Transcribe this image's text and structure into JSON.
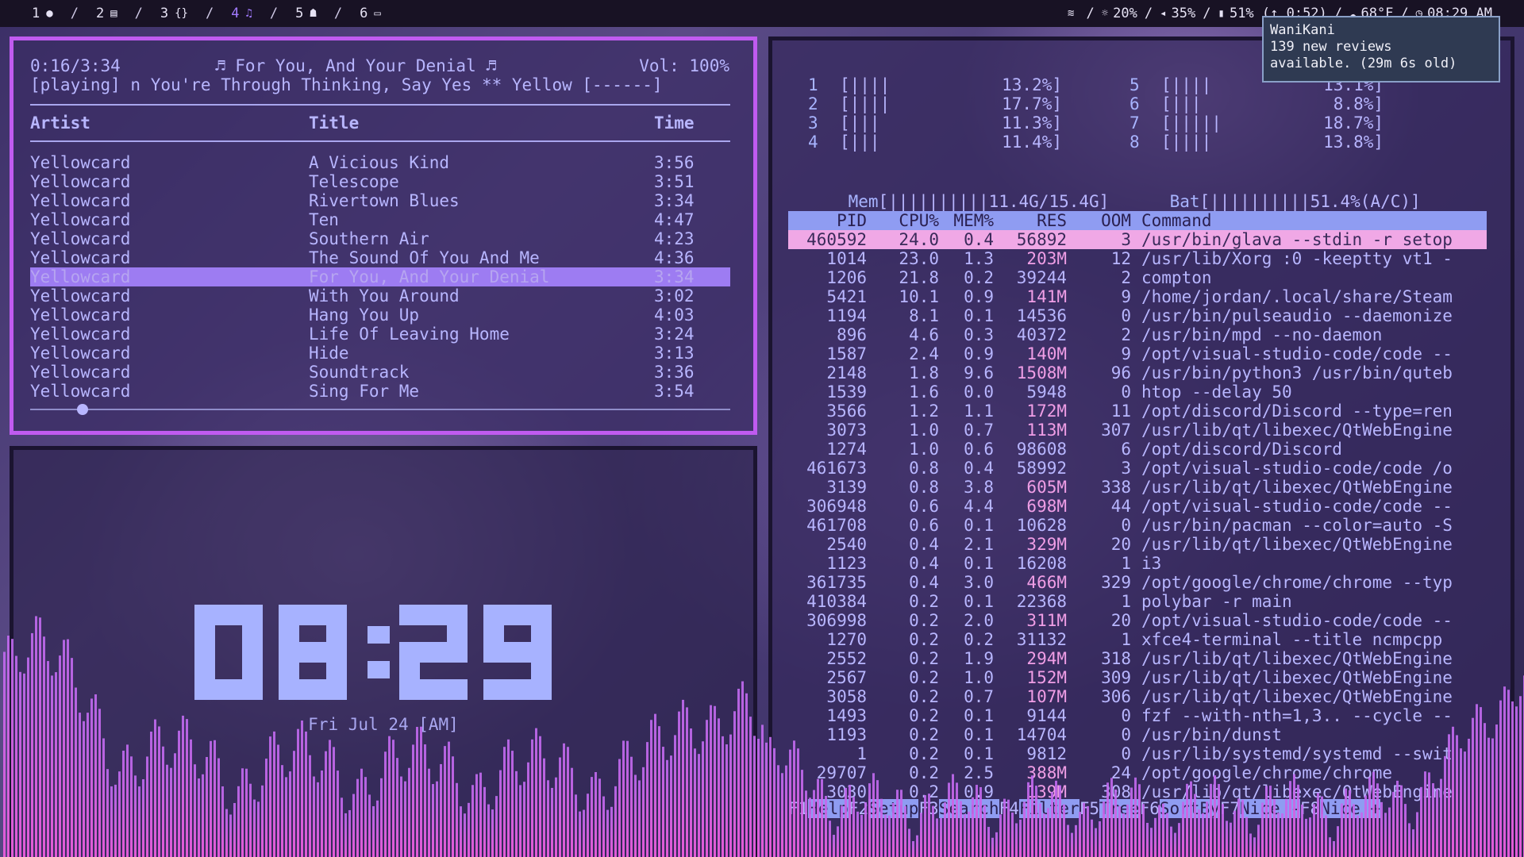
{
  "topbar": {
    "workspaces": [
      {
        "num": "1",
        "icon": "●",
        "icon_name": "circle-icon"
      },
      {
        "num": "2",
        "icon": "▤",
        "icon_name": "envelope-icon"
      },
      {
        "num": "3",
        "icon": "{}",
        "icon_name": "code-braces-icon"
      },
      {
        "num": "4",
        "icon": "♫",
        "icon_name": "headphones-icon",
        "active": true
      },
      {
        "num": "5",
        "icon": "☗",
        "icon_name": "gamepad-icon"
      },
      {
        "num": "6",
        "icon": "▭",
        "icon_name": "chat-icon"
      }
    ],
    "separator": "/",
    "status": [
      {
        "icon": "≋",
        "icon_name": "wifi-icon",
        "text": ""
      },
      {
        "icon": "☼",
        "icon_name": "brightness-icon",
        "text": "20%"
      },
      {
        "icon": "◂",
        "icon_name": "volume-icon",
        "text": "35%"
      },
      {
        "icon": "▮",
        "icon_name": "battery-icon",
        "text": "51% (↑ 0:52)"
      },
      {
        "icon": "☁",
        "icon_name": "weather-icon",
        "text": "68°F"
      },
      {
        "icon": "◷",
        "icon_name": "clock-icon",
        "text": "08:29 AM"
      }
    ],
    "active_color": "#a27bff"
  },
  "notification": {
    "title": "WaniKani",
    "line1": "139 new reviews",
    "line2": "available. (29m 6s old)"
  },
  "ncmpcpp": {
    "time": "0:16/3:34",
    "now_playing": "♬ For You, And Your Denial ♬",
    "volume": "Vol: 100%",
    "status_line": "[playing] n You're Through Thinking, Say Yes ** Yellow [------]",
    "columns": {
      "artist": "Artist",
      "title": "Title",
      "time": "Time"
    },
    "tracks": [
      {
        "artist": "Yellowcard",
        "title": "A Vicious Kind",
        "time": "3:56"
      },
      {
        "artist": "Yellowcard",
        "title": "Telescope",
        "time": "3:51"
      },
      {
        "artist": "Yellowcard",
        "title": "Rivertown Blues",
        "time": "3:34"
      },
      {
        "artist": "Yellowcard",
        "title": "Ten",
        "time": "4:47"
      },
      {
        "artist": "Yellowcard",
        "title": "Southern Air",
        "time": "4:23"
      },
      {
        "artist": "Yellowcard",
        "title": "The Sound Of You And Me",
        "time": "4:36"
      },
      {
        "artist": "Yellowcard",
        "title": "For You, And Your Denial",
        "time": "3:34",
        "selected": true
      },
      {
        "artist": "Yellowcard",
        "title": "With You Around",
        "time": "3:02"
      },
      {
        "artist": "Yellowcard",
        "title": "Hang You Up",
        "time": "4:03"
      },
      {
        "artist": "Yellowcard",
        "title": "Life Of Leaving Home",
        "time": "3:24"
      },
      {
        "artist": "Yellowcard",
        "title": "Hide",
        "time": "3:13"
      },
      {
        "artist": "Yellowcard",
        "title": "Soundtrack",
        "time": "3:36"
      },
      {
        "artist": "Yellowcard",
        "title": "Sing For Me",
        "time": "3:54"
      }
    ],
    "progress_fraction": 0.075,
    "border_color": "#c05bf0"
  },
  "clock": {
    "time": "08:29",
    "date": "Fri Jul 24 [AM]",
    "digit_color": "#a7b2ff"
  },
  "htop": {
    "cpus": [
      {
        "id": "1",
        "bar": "[||||",
        "pct": "13.2%]"
      },
      {
        "id": "2",
        "bar": "[||||",
        "pct": "17.7%]"
      },
      {
        "id": "3",
        "bar": "[|||",
        "pct": "11.3%]"
      },
      {
        "id": "4",
        "bar": "[|||",
        "pct": "11.4%]"
      },
      {
        "id": "5",
        "bar": "[||||",
        "pct": "13.1%]"
      },
      {
        "id": "6",
        "bar": "[|||",
        "pct": "8.8%]"
      },
      {
        "id": "7",
        "bar": "[|||||",
        "pct": "18.7%]"
      },
      {
        "id": "8",
        "bar": "[||||",
        "pct": "13.8%]"
      }
    ],
    "mem": {
      "label": "Mem",
      "bar": "[||||||||||",
      "value": "11.4G/15.4G]"
    },
    "bat": {
      "label": "Bat",
      "bar": "[||||||||||",
      "value": "51.4%(A/C)]"
    },
    "headers": {
      "pid": "PID",
      "cpu": "CPU%",
      "mem": "MEM%",
      "res": "RES",
      "oom": "OOM",
      "command": "Command"
    },
    "processes": [
      {
        "pid": "460592",
        "cpu": "24.0",
        "mem": "0.4",
        "res": "56892",
        "oom": "3",
        "cmd": "/usr/bin/glava --stdin -r setop",
        "selected": true
      },
      {
        "pid": "1014",
        "cpu": "23.0",
        "mem": "1.3",
        "res": "203M",
        "oom": "12",
        "cmd": "/usr/lib/Xorg :0 -keeptty vt1 -"
      },
      {
        "pid": "1206",
        "cpu": "21.8",
        "mem": "0.2",
        "res": "39244",
        "oom": "2",
        "cmd": "compton"
      },
      {
        "pid": "5421",
        "cpu": "10.1",
        "mem": "0.9",
        "res": "141M",
        "oom": "9",
        "cmd": "/home/jordan/.local/share/Steam"
      },
      {
        "pid": "1194",
        "cpu": "8.1",
        "mem": "0.1",
        "res": "14536",
        "oom": "0",
        "cmd": "/usr/bin/pulseaudio --daemonize"
      },
      {
        "pid": "896",
        "cpu": "4.6",
        "mem": "0.3",
        "res": "40372",
        "oom": "2",
        "cmd": "/usr/bin/mpd --no-daemon"
      },
      {
        "pid": "1587",
        "cpu": "2.4",
        "mem": "0.9",
        "res": "140M",
        "oom": "9",
        "cmd": "/opt/visual-studio-code/code --"
      },
      {
        "pid": "2148",
        "cpu": "1.8",
        "mem": "9.6",
        "res": "1508M",
        "oom": "96",
        "cmd": "/usr/bin/python3 /usr/bin/quteb"
      },
      {
        "pid": "1539",
        "cpu": "1.6",
        "mem": "0.0",
        "res": "5948",
        "oom": "0",
        "cmd": "htop --delay 50"
      },
      {
        "pid": "3566",
        "cpu": "1.2",
        "mem": "1.1",
        "res": "172M",
        "oom": "11",
        "cmd": "/opt/discord/Discord --type=ren"
      },
      {
        "pid": "3073",
        "cpu": "1.0",
        "mem": "0.7",
        "res": "113M",
        "oom": "307",
        "cmd": "/usr/lib/qt/libexec/QtWebEngine"
      },
      {
        "pid": "1274",
        "cpu": "1.0",
        "mem": "0.6",
        "res": "98608",
        "oom": "6",
        "cmd": "/opt/discord/Discord"
      },
      {
        "pid": "461673",
        "cpu": "0.8",
        "mem": "0.4",
        "res": "58992",
        "oom": "3",
        "cmd": "/opt/visual-studio-code/code /o"
      },
      {
        "pid": "3139",
        "cpu": "0.8",
        "mem": "3.8",
        "res": "605M",
        "oom": "338",
        "cmd": "/usr/lib/qt/libexec/QtWebEngine"
      },
      {
        "pid": "306948",
        "cpu": "0.6",
        "mem": "4.4",
        "res": "698M",
        "oom": "44",
        "cmd": "/opt/visual-studio-code/code --"
      },
      {
        "pid": "461708",
        "cpu": "0.6",
        "mem": "0.1",
        "res": "10628",
        "oom": "0",
        "cmd": "/usr/bin/pacman --color=auto -S"
      },
      {
        "pid": "2540",
        "cpu": "0.4",
        "mem": "2.1",
        "res": "329M",
        "oom": "20",
        "cmd": "/usr/lib/qt/libexec/QtWebEngine"
      },
      {
        "pid": "1123",
        "cpu": "0.4",
        "mem": "0.1",
        "res": "16208",
        "oom": "1",
        "cmd": "i3"
      },
      {
        "pid": "361735",
        "cpu": "0.4",
        "mem": "3.0",
        "res": "466M",
        "oom": "329",
        "cmd": "/opt/google/chrome/chrome --typ"
      },
      {
        "pid": "410384",
        "cpu": "0.2",
        "mem": "0.1",
        "res": "22368",
        "oom": "1",
        "cmd": "polybar -r main"
      },
      {
        "pid": "306998",
        "cpu": "0.2",
        "mem": "2.0",
        "res": "311M",
        "oom": "20",
        "cmd": "/opt/visual-studio-code/code --"
      },
      {
        "pid": "1270",
        "cpu": "0.2",
        "mem": "0.2",
        "res": "31132",
        "oom": "1",
        "cmd": "xfce4-terminal --title ncmpcpp"
      },
      {
        "pid": "2552",
        "cpu": "0.2",
        "mem": "1.9",
        "res": "294M",
        "oom": "318",
        "cmd": "/usr/lib/qt/libexec/QtWebEngine"
      },
      {
        "pid": "2567",
        "cpu": "0.2",
        "mem": "1.0",
        "res": "152M",
        "oom": "309",
        "cmd": "/usr/lib/qt/libexec/QtWebEngine"
      },
      {
        "pid": "3058",
        "cpu": "0.2",
        "mem": "0.7",
        "res": "107M",
        "oom": "306",
        "cmd": "/usr/lib/qt/libexec/QtWebEngine"
      },
      {
        "pid": "1493",
        "cpu": "0.2",
        "mem": "0.1",
        "res": "9144",
        "oom": "0",
        "cmd": "fzf --with-nth=1,3.. --cycle --"
      },
      {
        "pid": "1193",
        "cpu": "0.2",
        "mem": "0.1",
        "res": "14704",
        "oom": "0",
        "cmd": "/usr/bin/dunst"
      },
      {
        "pid": "1",
        "cpu": "0.2",
        "mem": "0.1",
        "res": "9812",
        "oom": "0",
        "cmd": "/usr/lib/systemd/systemd --swit"
      },
      {
        "pid": "29707",
        "cpu": "0.2",
        "mem": "2.5",
        "res": "388M",
        "oom": "24",
        "cmd": "/opt/google/chrome/chrome"
      },
      {
        "pid": "3030",
        "cpu": "0.2",
        "mem": "0.9",
        "res": "139M",
        "oom": "308",
        "cmd": "/usr/lib/qt/libexec/QtWebEngine"
      }
    ],
    "fkeys": [
      {
        "key": "F1",
        "label": "Help"
      },
      {
        "key": "F2",
        "label": "Setup"
      },
      {
        "key": "F3",
        "label": "Search"
      },
      {
        "key": "F4",
        "label": "Filter"
      },
      {
        "key": "F5",
        "label": "Tree"
      },
      {
        "key": "F6",
        "label": "SortBy"
      },
      {
        "key": "F7",
        "label": "Nice -"
      },
      {
        "key": "F8",
        "label": "Nice +"
      }
    ],
    "header_bg": "#8f9cf2",
    "selected_bg": "#f0a8e6"
  },
  "visualizer": {
    "color_top": "#c06af0",
    "color_bottom": "#e35bd6"
  }
}
